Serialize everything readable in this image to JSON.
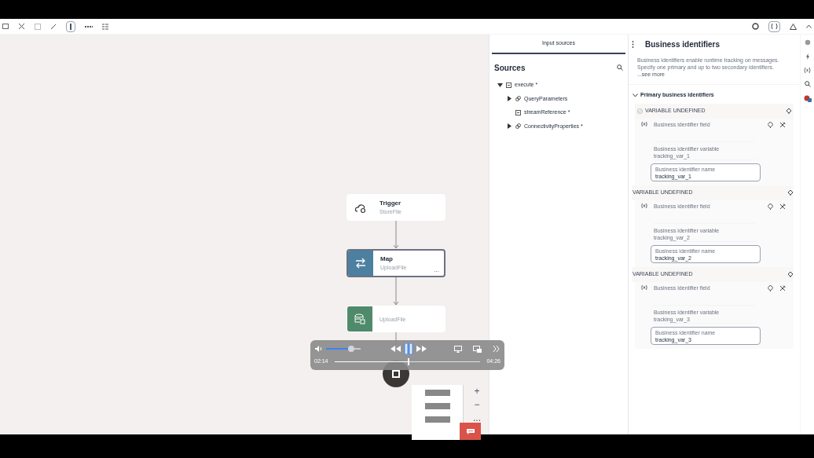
{
  "flow": {
    "nodes": [
      {
        "kind": "trigger",
        "title": "Trigger",
        "subtitle": "StoreFile",
        "selected": false
      },
      {
        "kind": "map",
        "title": "Map",
        "subtitle": "UploadFile",
        "selected": true,
        "menu": "..."
      },
      {
        "kind": "action",
        "subtitle": "UploadFile",
        "selected": false
      }
    ],
    "zoom_controls": [
      "+",
      "−",
      "..."
    ]
  },
  "video_player": {
    "volume": {
      "level": 0.72
    },
    "playing": true,
    "elapsed": "02:14",
    "duration": "04:26",
    "progress": {
      "level": 0.5
    }
  },
  "input_sources": {
    "tabs": [
      {
        "label": "Input sources",
        "selected": true
      }
    ],
    "title": "Sources",
    "tree": [
      {
        "label": "execute *",
        "kind": "operation",
        "expanded": true,
        "children": [
          {
            "label": "QueryParameters",
            "kind": "group",
            "expanded": false
          },
          {
            "label": "streamReference *",
            "kind": "leaf"
          },
          {
            "label": "ConnectivityProperties *",
            "kind": "group",
            "expanded": false
          }
        ]
      }
    ]
  },
  "business_identifiers": {
    "title": "Business identifiers",
    "description": "Business identifiers enable runtime tracking on messages. Specify one primary and up to two secondary identifiers.",
    "see_more": "...see more",
    "section": {
      "title": "Primary business identifiers",
      "expanded": true
    },
    "identifiers": [
      {
        "header": "VARIABLE UNDEFINED",
        "primary": true,
        "field_label": "Business identifier field",
        "variable_label": "Business identifier variable",
        "variable_value": "tracking_var_1",
        "name_label": "Business identifier name",
        "name_value": "tracking_var_1"
      },
      {
        "header": "VARIABLE UNDEFINED",
        "primary": false,
        "field_label": "Business identifier field",
        "variable_label": "Business identifier variable",
        "variable_value": "tracking_var_2",
        "name_label": "Business identifier name",
        "name_value": "tracking_var_2"
      },
      {
        "header": "VARIABLE UNDEFINED",
        "primary": false,
        "field_label": "Business identifier field",
        "variable_label": "Business identifier variable",
        "variable_value": "tracking_var_3",
        "name_label": "Business identifier name",
        "name_value": "tracking_var_3"
      }
    ]
  }
}
